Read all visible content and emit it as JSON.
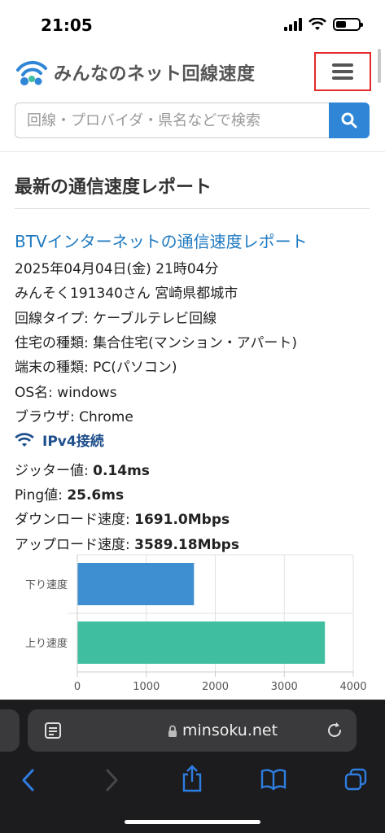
{
  "status_bar": {
    "time": "21:05"
  },
  "header": {
    "logo_text": "みんなのネット回線速度",
    "menu_icon": "hamburger-icon"
  },
  "search": {
    "placeholder": "回線・プロバイダ・県名などで検索",
    "value": "",
    "button_icon": "search-icon"
  },
  "section": {
    "title": "最新の通信速度レポート"
  },
  "report": {
    "title": "BTVインターネットの通信速度レポート",
    "datetime": "2025年04月04日(金) 21時04分",
    "user": "みんそく191340さん 宮崎県都城市",
    "line_type": "回線タイプ: ケーブルテレビ回線",
    "housing": "住宅の種類: 集合住宅(マンション・アパート)",
    "device": "端末の種類: PC(パソコン)",
    "os": "OS名: windows",
    "browser": "ブラウザ: Chrome",
    "connection": "IPv4接続",
    "jitter_label": "ジッター値: ",
    "jitter_value": "0.14ms",
    "ping_label": "Ping値: ",
    "ping_value": "25.6ms",
    "download_label": "ダウンロード速度: ",
    "download_value": "1691.0Mbps",
    "upload_label": "アップロード速度: ",
    "upload_value": "3589.18Mbps"
  },
  "chart_data": {
    "type": "bar",
    "orientation": "horizontal",
    "categories": [
      "下り速度",
      "上り速度"
    ],
    "values": [
      1691.0,
      3589.18
    ],
    "colors": [
      "#3d8fd1",
      "#3fbf9f"
    ],
    "xlim": [
      0,
      4000
    ],
    "xticks": [
      0,
      1000,
      2000,
      3000,
      4000
    ],
    "grid": true,
    "title": "",
    "xlabel": "",
    "ylabel": ""
  },
  "browser_bar": {
    "url": "minsoku.net"
  }
}
